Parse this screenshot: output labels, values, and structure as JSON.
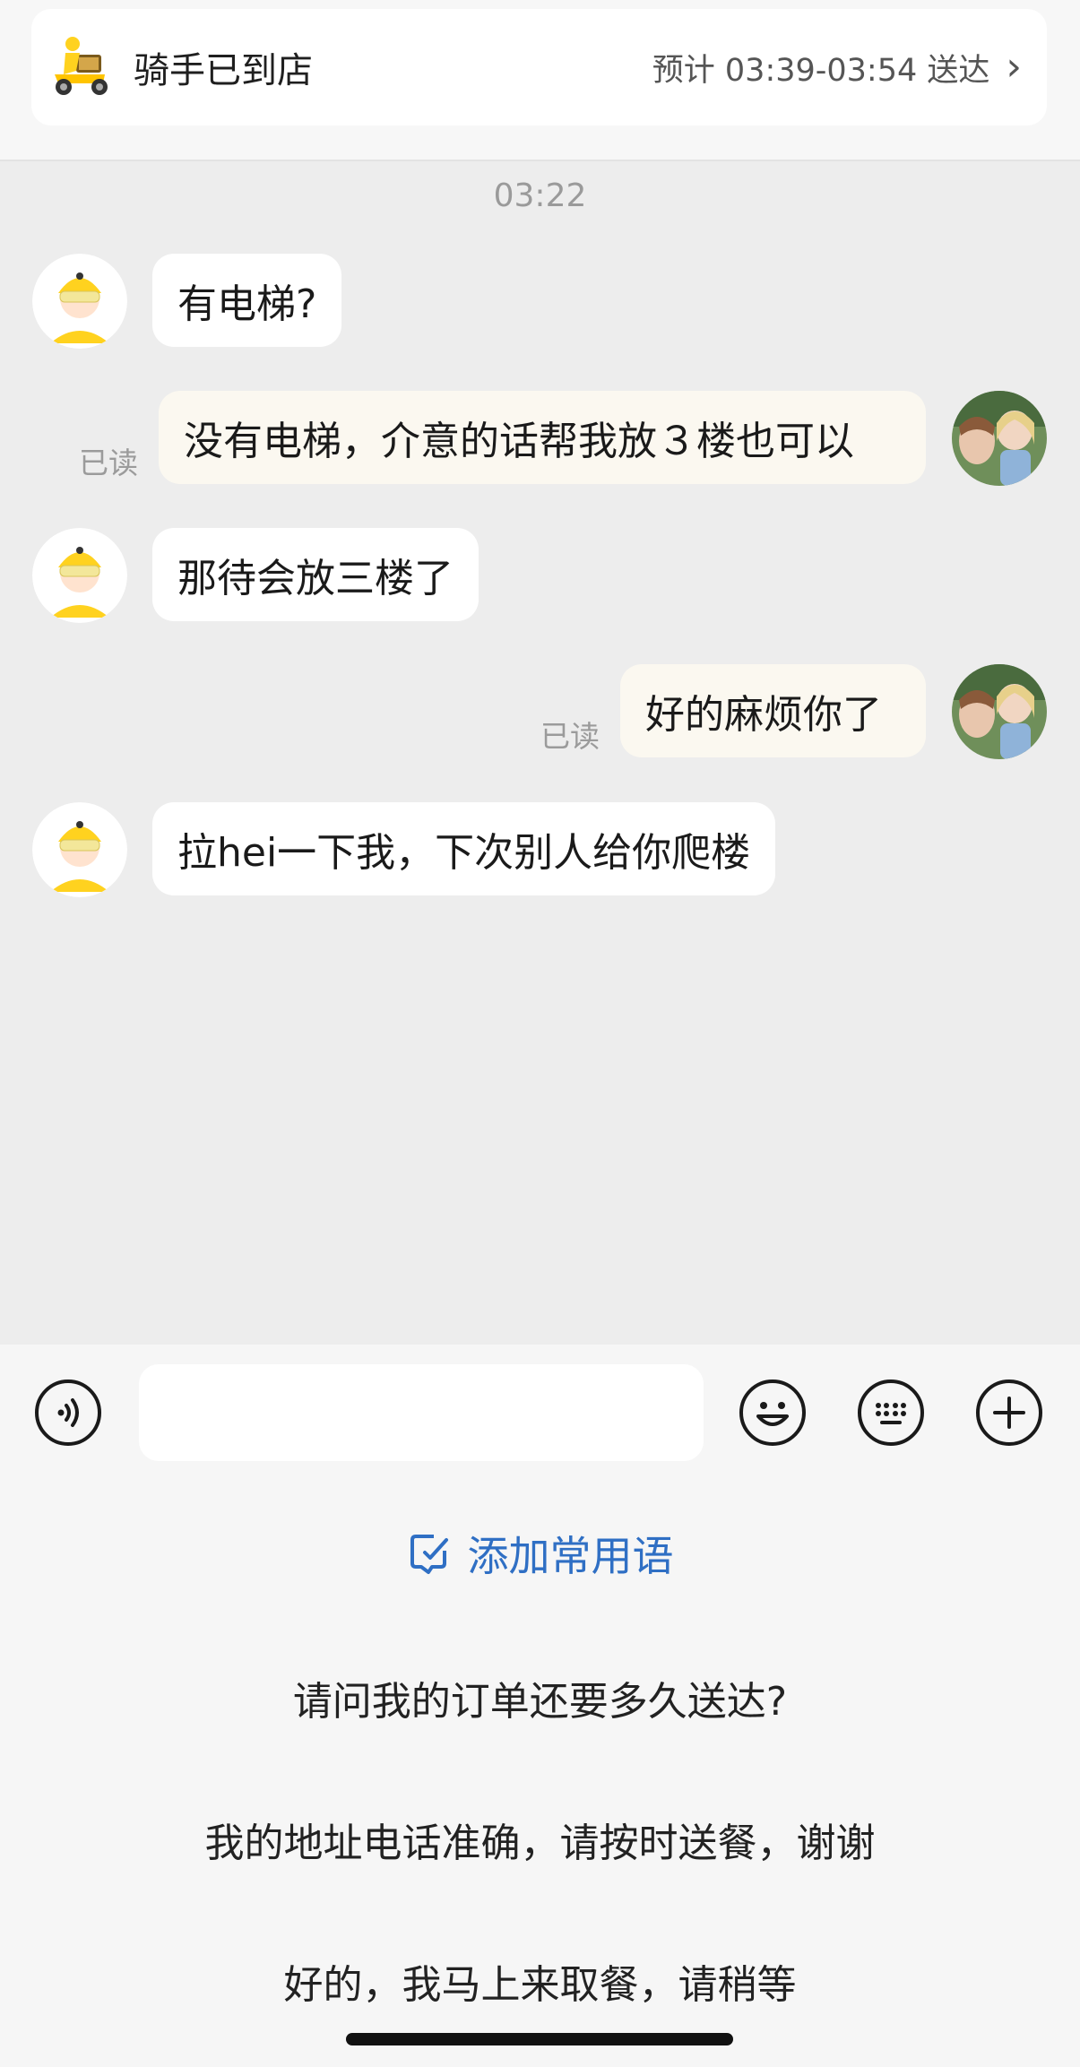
{
  "header": {
    "status_title": "骑手已到店",
    "eta": "预计 03:39-03:54 送达"
  },
  "chat": {
    "timestamp": "03:22",
    "messages": [
      {
        "from": "rider",
        "text": "有电梯?"
      },
      {
        "from": "me",
        "text": "没有电梯，介意的话帮我放３楼也可以",
        "read": "已读"
      },
      {
        "from": "rider",
        "text": "那待会放三楼了"
      },
      {
        "from": "me",
        "text": "好的麻烦你了",
        "read": "已读"
      },
      {
        "from": "rider",
        "text": "拉hei一下我，下次别人给你爬楼"
      }
    ]
  },
  "input": {
    "placeholder": "",
    "icons": [
      "voice-icon",
      "emoji-icon",
      "keyboard-icon",
      "plus-icon"
    ]
  },
  "quick_replies": {
    "add_label": "添加常用语",
    "items": [
      "请问我的订单还要多久送达?",
      "我的地址电话准确，请按时送餐，谢谢",
      "好的，我马上来取餐，请稍等"
    ]
  },
  "colors": {
    "accent_blue": "#2f6fc4",
    "rider_yellow": "#ffd21f",
    "outgoing_bubble": "#fbf8f0"
  }
}
